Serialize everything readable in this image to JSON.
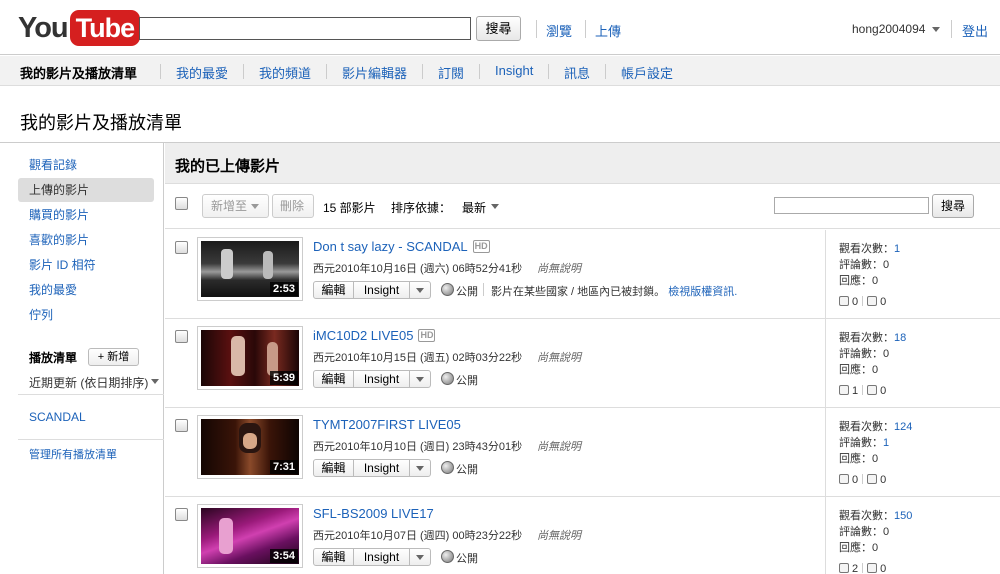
{
  "masthead": {
    "logo_you": "You",
    "logo_tube": "Tube",
    "search_button": "搜尋",
    "browse": "瀏覽",
    "upload": "上傳",
    "username": "hong2004094",
    "signout": "登出"
  },
  "nav": {
    "items": [
      "我的影片及播放清單",
      "我的最愛",
      "我的頻道",
      "影片編輯器",
      "訂閱",
      "Insight",
      "訊息",
      "帳戶設定"
    ]
  },
  "page_title": "我的影片及播放清單",
  "sidebar": {
    "items": [
      "觀看記錄",
      "上傳的影片",
      "購買的影片",
      "喜歡的影片",
      "影片 ID 相符",
      "我的最愛",
      "佇列"
    ],
    "playlist_heading": "播放清單",
    "new_button": "+ 新增",
    "sort": "近期更新 (依日期排序)",
    "playlists": [
      "SCANDAL"
    ],
    "manage": "管理所有播放清單"
  },
  "main": {
    "title": "我的已上傳影片",
    "add_to": "新增至",
    "delete": "刪除",
    "count": "15 部影片",
    "sort_label": "排序依據：",
    "sort_value": "最新",
    "search_button": "搜尋"
  },
  "labels": {
    "edit": "編輯",
    "insight": "Insight",
    "public": "公開",
    "no_desc": "尚無說明",
    "views": "觀看次數：",
    "comments": "評論數：",
    "replies": "回應："
  },
  "videos": [
    {
      "title": "Don t say lazy - SCANDAL",
      "hd": "HD",
      "date": "西元2010年10月16日 (週六) 06時52分41秒",
      "duration": "2:53",
      "note": "影片在某些國家 / 地區內已被封鎖。",
      "note_link": "檢視版權資訊.",
      "views": "1",
      "comments": "0",
      "replies": "0",
      "likes": "0",
      "dislikes": "0"
    },
    {
      "title": "iMC10D2 LIVE05",
      "hd": "HD",
      "date": "西元2010年10月15日 (週五) 02時03分22秒",
      "duration": "5:39",
      "views": "18",
      "comments": "0",
      "replies": "0",
      "likes": "1",
      "dislikes": "0"
    },
    {
      "title": "TYMT2007FIRST LIVE05",
      "date": "西元2010年10月10日 (週日) 23時43分01秒",
      "duration": "7:31",
      "views": "124",
      "comments": "1",
      "replies": "0",
      "likes": "0",
      "dislikes": "0"
    },
    {
      "title": "SFL-BS2009 LIVE17",
      "date": "西元2010年10月07日 (週四) 00時23分22秒",
      "duration": "3:54",
      "views": "150",
      "comments": "0",
      "replies": "0",
      "likes": "2",
      "dislikes": "0"
    }
  ],
  "colors": {
    "link": "#1c62b9",
    "logo_red": "#d51f1f",
    "nav_bg": "#f2f2f2"
  }
}
